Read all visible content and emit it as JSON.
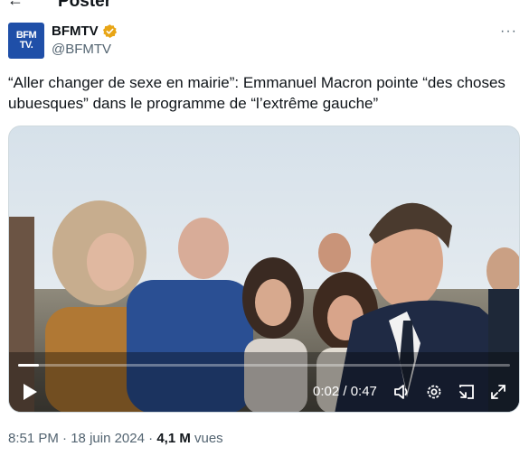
{
  "topbar": {
    "title": "Poster"
  },
  "account": {
    "avatar_line1": "BFM",
    "avatar_line2": "TV.",
    "display_name": "BFMTV",
    "handle": "@BFMTV",
    "verified_color": "#e8a515"
  },
  "tweet": {
    "text": "“Aller changer de sexe en mairie”: Emmanuel Macron pointe “des choses ubuesques” dans le programme de “l’extrême gauche”"
  },
  "video": {
    "time_display": "0:02 / 0:47",
    "progress_fraction": 0.043,
    "icons": [
      "play-icon",
      "volume-icon",
      "settings-icon",
      "pip-icon",
      "fullscreen-icon"
    ]
  },
  "meta": {
    "time": "8:51 PM",
    "separator": " · ",
    "date": "18 juin 2024",
    "views_count": "4,1 M",
    "views_label": "vues"
  },
  "colors": {
    "text": "#0f1419",
    "secondary": "#536471",
    "brand_blue": "#1f4fa8"
  }
}
